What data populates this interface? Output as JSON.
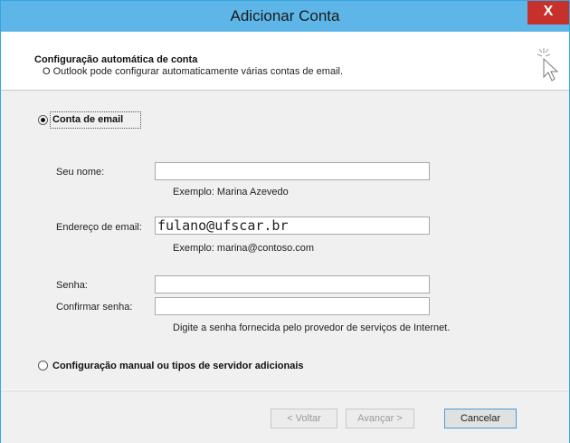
{
  "window": {
    "title": "Adicionar Conta",
    "close_label": "X"
  },
  "header": {
    "title": "Configuração automática de conta",
    "description": "O Outlook pode configurar automaticamente várias contas de email.",
    "icon": "cursor-sparkle-icon"
  },
  "options": {
    "email_account_label": "Conta de email",
    "manual_setup_label": "Configuração manual ou tipos de servidor adicionais",
    "selected": "email"
  },
  "form": {
    "name_label": "Seu nome:",
    "name_value": "",
    "name_hint": "Exemplo: Marina Azevedo",
    "email_label": "Endereço de email:",
    "email_value": "fulano@ufscar.br",
    "email_hint": "Exemplo: marina@contoso.com",
    "password_label": "Senha:",
    "password_value": "",
    "confirm_label": "Confirmar senha:",
    "confirm_value": "",
    "password_hint": "Digite a senha fornecida pelo provedor de serviços de Internet."
  },
  "buttons": {
    "back": "< Voltar",
    "next": "Avançar >",
    "cancel": "Cancelar"
  },
  "colors": {
    "titlebar": "#5eb6e8",
    "close": "#c7312b"
  }
}
